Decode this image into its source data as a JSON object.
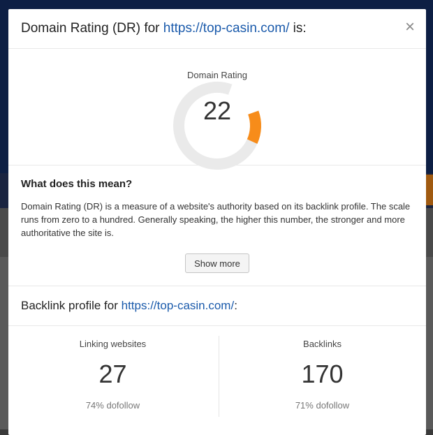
{
  "modal": {
    "title_prefix": "Domain Rating (DR) for ",
    "title_url": "https://top-casin.com/",
    "title_suffix": " is:",
    "close_symbol": "×"
  },
  "gauge": {
    "label": "Domain Rating",
    "value": "22",
    "fraction": 0.22,
    "track_color": "#eaeaea",
    "fill_color": "#f78c1a"
  },
  "meaning": {
    "title": "What does this mean?",
    "text": "Domain Rating (DR) is a measure of a website's authority based on its backlink profile. The scale runs from zero to a hundred. Generally speaking, the higher this number, the stronger and more authoritative the site is.",
    "show_more": "Show more"
  },
  "backlink": {
    "title_prefix": "Backlink profile for ",
    "title_url": "https://top-casin.com/",
    "title_suffix": ":",
    "linking": {
      "label": "Linking websites",
      "value": "27",
      "sub": "74% dofollow"
    },
    "backlinks": {
      "label": "Backlinks",
      "value": "170",
      "sub": "71% dofollow"
    }
  },
  "colors": {
    "link": "#1a5aab",
    "accent": "#f78c1a"
  }
}
